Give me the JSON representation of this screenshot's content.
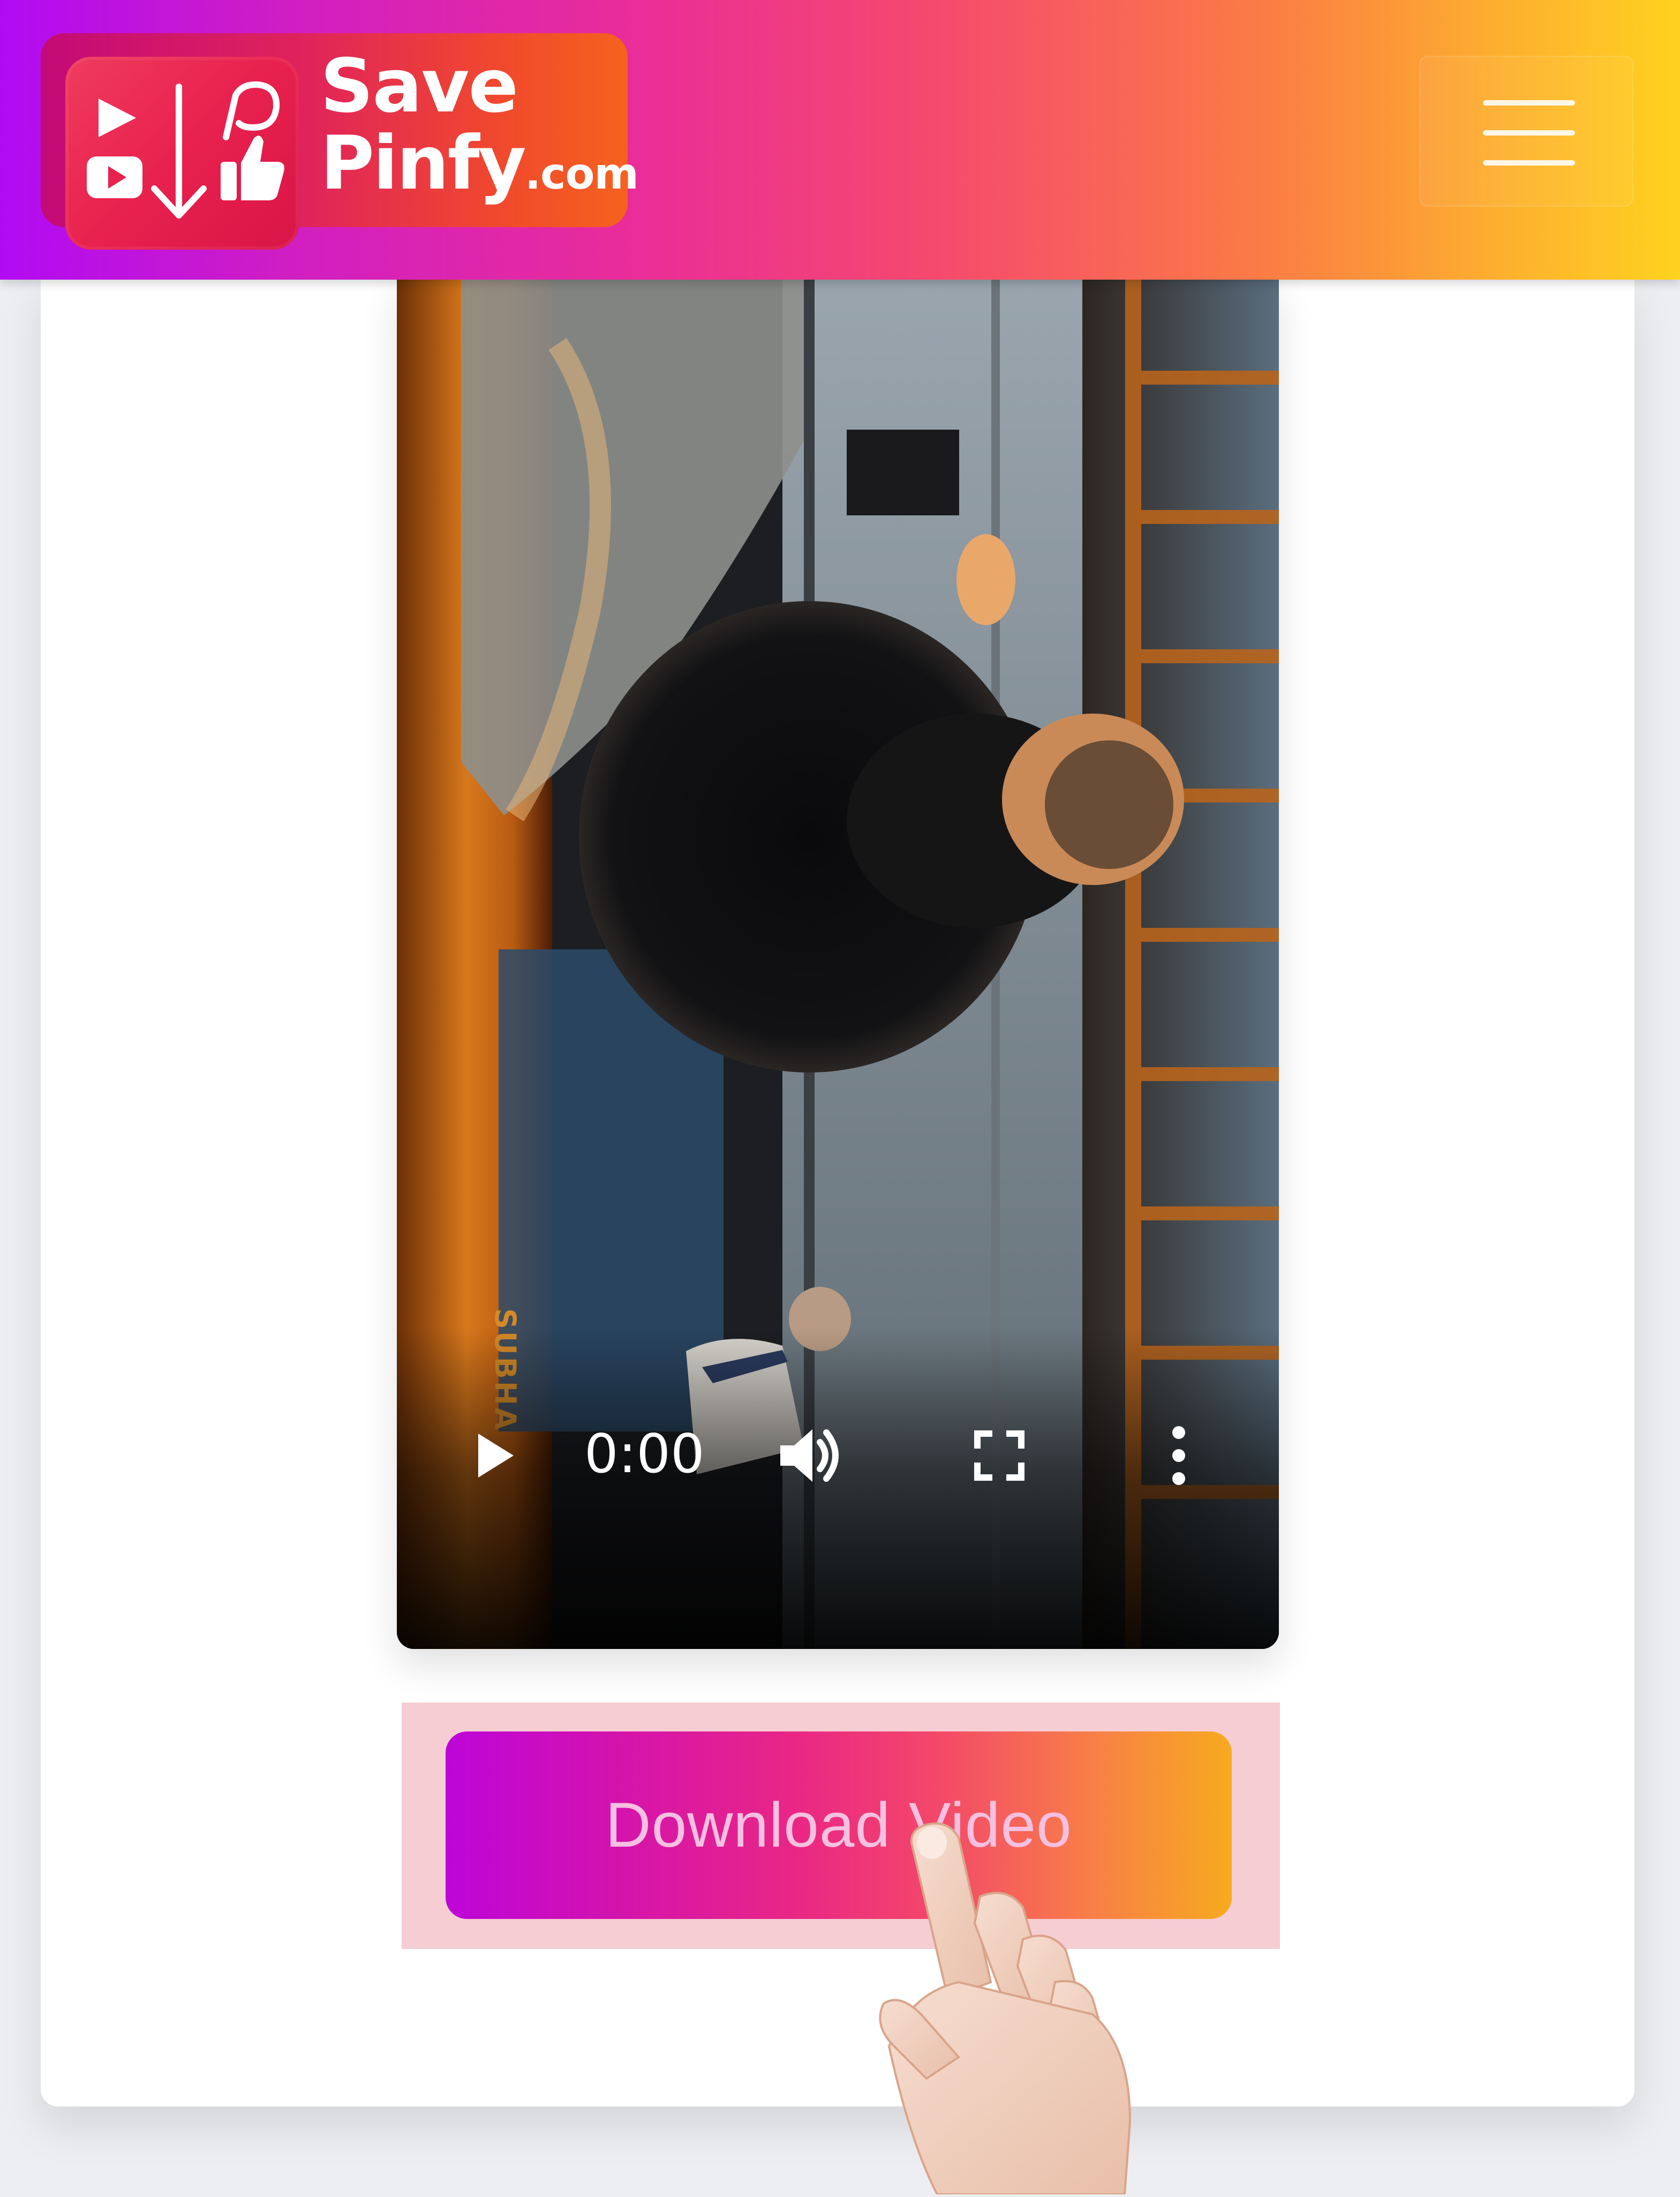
{
  "header": {
    "logo": {
      "line1": "Save",
      "line2": "Pinfy",
      "suffix": ".com"
    },
    "menu_icon": "hamburger-menu-icon"
  },
  "video": {
    "time": "0:00",
    "progress": 0.0,
    "controls": {
      "play_icon": "play-icon",
      "volume_icon": "volume-icon",
      "fullscreen_icon": "fullscreen-icon",
      "more_icon": "more-vertical-icon"
    },
    "watermark": "SUBHA"
  },
  "download": {
    "label": "Download Video"
  },
  "colors": {
    "header_gradient": [
      "#b10bf2",
      "#ea2d98",
      "#fb7b45",
      "#ffd21f"
    ],
    "button_gradient": [
      "#bd05d9",
      "#ea2784",
      "#f87e48",
      "#f7aa1f"
    ],
    "highlight": "#f5cdd3"
  }
}
